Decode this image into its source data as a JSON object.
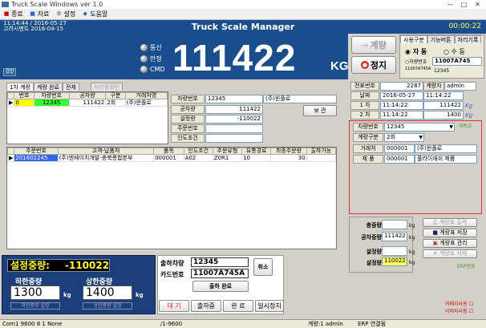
{
  "window": {
    "title": "Truck Scale Windows ver 1.0",
    "min": "—",
    "max": "□",
    "close": "✕"
  },
  "menu": [
    {
      "label": "종료",
      "icon": "exit-icon"
    },
    {
      "label": "자료",
      "icon": "data-icon"
    },
    {
      "label": "설정",
      "icon": "settings-icon"
    },
    {
      "label": "도움말",
      "icon": "help-icon"
    }
  ],
  "header": {
    "datetime": "11:14:44 / 2016-05-27",
    "company": "고려시멘트  2016-04-15",
    "title": "Truck Scale Manager",
    "clock": "00:00:22"
  },
  "display": {
    "leds": [
      "통신",
      "안정",
      "CMD"
    ],
    "weight": "111422",
    "unit": "KG",
    "mode_btn": "결합"
  },
  "controls": {
    "weigh_btn": "계량",
    "stop_btn": "정지",
    "tabs": [
      "사용구분",
      "기능버튼",
      "처리기록"
    ],
    "auto": "자 동",
    "manual": "수 동",
    "vehicle_label": "차량번호",
    "vehicle_value": "11007A745",
    "vehicle_sub": "11007A745A",
    "vehicle_sub2": "12345"
  },
  "slip": {
    "no_label": "전표번호",
    "no_value": "2287",
    "operator_label": "계량자",
    "operator_value": "admin",
    "date_label": "날짜",
    "date_value": "2016-05-27",
    "time_value": "11:14:22",
    "rows": [
      {
        "label": "1 차",
        "time": "11:14:22",
        "value": "111422",
        "unit": "Kg"
      },
      {
        "label": "2 차",
        "time": "11:14:22",
        "value": "1400",
        "unit": "Kg"
      }
    ]
  },
  "detail": {
    "vehicle_label": "차량번호",
    "vehicle_value": "12345",
    "type_label": "계량구분",
    "type_value": "2회",
    "client_label": "거래처",
    "client_code": "000001",
    "client_name": "(주)윈플로",
    "product_label": "제   품",
    "product_code": "000001",
    "product_name": "플라이애쉬 제품",
    "auto_check": "자동"
  },
  "weights": {
    "total_label": "총중량",
    "total_value": "",
    "empty_label": "공차중량",
    "empty_value": "111422",
    "set_label": "설정량",
    "set_value": "",
    "net_label": "설정량",
    "net_value": "110022",
    "unit": "kg"
  },
  "print": {
    "btns": [
      "계량표 출력",
      "계량표 저장",
      "계량표 관리",
      "계량표 삭제"
    ],
    "erp": "ERP전송"
  },
  "grid1": {
    "tabs": [
      "1차 계량",
      "계량 완료",
      "전체"
    ],
    "extra_tab": "처리중확인",
    "headers": [
      "번호",
      "차량번호",
      "공차량",
      "구분",
      "거래처명"
    ],
    "rows": [
      {
        "no": "0",
        "vehicle": "12345",
        "empty": "111422",
        "type": "2회",
        "client": "(주)윈플로"
      }
    ]
  },
  "form": {
    "vehicle_label": "차량번호",
    "vehicle_value": "12345",
    "vehicle_client": "(주)윈플로",
    "empty_label": "공차량",
    "empty_value": "111422",
    "set_label": "설정량",
    "set_value": "-110022",
    "order_label": "주문번호",
    "order_value": "",
    "delivery_label": "인도조건",
    "delivery_value": "",
    "save_btn": "보 관"
  },
  "grid2": {
    "headers": [
      "주문번호",
      "고객-납품처",
      "품목",
      "인도조건",
      "주문유형",
      "유통경로",
      "최종주문량",
      "출하가능"
    ],
    "rows": [
      {
        "order": "201602245",
        "client": "(주)엔웨이치개발-충북롱합본부",
        "item": "000001",
        "cond": "A02",
        "type": "Z0R1",
        "route": "10",
        "qty": "30",
        "avail": ""
      }
    ]
  },
  "setpanel": {
    "label": "설정중량:",
    "value": "-110022",
    "low_label": "하한중량",
    "low_value": "1300",
    "low_btn": "하한중량 설정",
    "high_label": "상한중량",
    "high_value": "1400",
    "high_btn": "상한중량 설정",
    "unit": "kg"
  },
  "shipping": {
    "vehicle_label": "출하차량",
    "vehicle_value": "12345",
    "card_label": "카드번호",
    "card_value": "11007A745A",
    "cancel_btn": "취소",
    "done_btn": "출하 완료",
    "status_btns": [
      "대 기",
      "출하중",
      "완 료",
      "일시정지"
    ]
  },
  "options": {
    "a": "커메라사용",
    "b": "이미지사용"
  },
  "status": {
    "port": "Com1 9600 8 1 None",
    "page": "/1-9600",
    "user": "계량:1 admin",
    "erp": "ERP 연결됨"
  }
}
